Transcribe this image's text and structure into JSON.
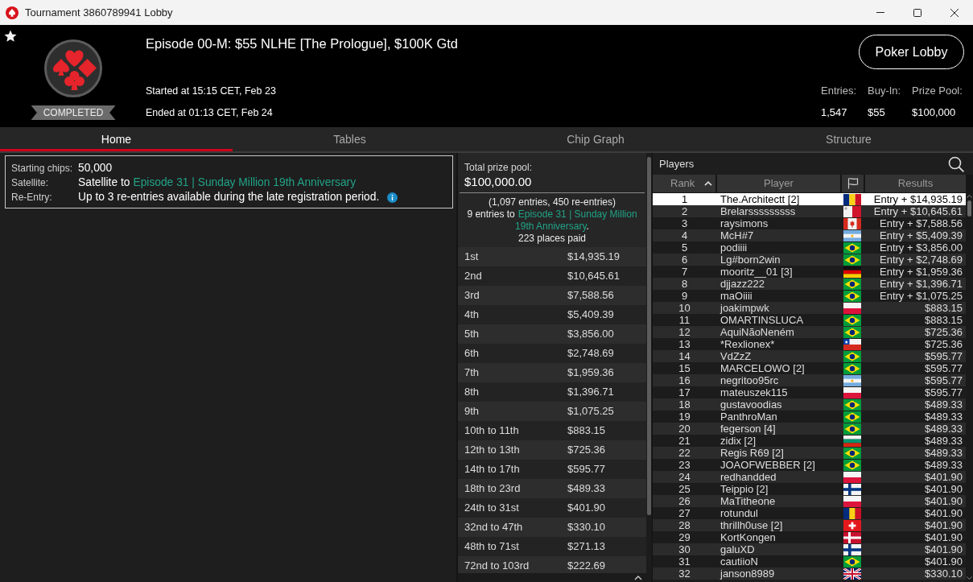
{
  "window": {
    "title": "Tournament 3860789941 Lobby"
  },
  "header": {
    "status": "COMPLETED",
    "title": "Episode 00-M: $55 NLHE [The Prologue], $100K Gtd",
    "started": "Started at 15:15 CET, Feb 23",
    "ended": "Ended at 01:13 CET, Feb 24",
    "lobby_button": "Poker Lobby",
    "stats": [
      {
        "label": "Entries:",
        "value": "1,547"
      },
      {
        "label": "Buy-In:",
        "value": "$55"
      },
      {
        "label": "Prize Pool:",
        "value": "$100,000"
      }
    ]
  },
  "tabs": [
    {
      "label": "Home",
      "selected": true
    },
    {
      "label": "Tables",
      "selected": false
    },
    {
      "label": "Chip Graph",
      "selected": false
    },
    {
      "label": "Structure",
      "selected": false
    }
  ],
  "details": [
    {
      "kind": "plain",
      "label": "Starting chips:",
      "value": "50,000"
    },
    {
      "kind": "link",
      "label": "Satellite:",
      "value": "Satellite to",
      "link": "Episode 31 | Sunday Million 19th Anniversary"
    },
    {
      "kind": "info",
      "label": "Re-Entry:",
      "value": "Up to 3 re-entries available during the late registration period."
    }
  ],
  "prize_pool": {
    "label": "Total prize pool:",
    "amount": "$100,000.00",
    "entries_note": "(1,097 entries, 450 re-entries)",
    "satellite_before": "9 entries to",
    "satellite_link_lines": [
      "Episode 31 | Sunday Million",
      "19th Anniversary"
    ],
    "satellite_after": ".",
    "places_paid": "223 places paid",
    "payouts": [
      {
        "place": "1st",
        "amount": "$14,935.19"
      },
      {
        "place": "2nd",
        "amount": "$10,645.61"
      },
      {
        "place": "3rd",
        "amount": "$7,588.56"
      },
      {
        "place": "4th",
        "amount": "$5,409.39"
      },
      {
        "place": "5th",
        "amount": "$3,856.00"
      },
      {
        "place": "6th",
        "amount": "$2,748.69"
      },
      {
        "place": "7th",
        "amount": "$1,959.36"
      },
      {
        "place": "8th",
        "amount": "$1,396.71"
      },
      {
        "place": "9th",
        "amount": "$1,075.25"
      },
      {
        "place": "10th to 11th",
        "amount": "$883.15"
      },
      {
        "place": "12th to 13th",
        "amount": "$725.36"
      },
      {
        "place": "14th to 17th",
        "amount": "$595.77"
      },
      {
        "place": "18th to 23rd",
        "amount": "$489.33"
      },
      {
        "place": "24th to 31st",
        "amount": "$401.90"
      },
      {
        "place": "32nd to 47th",
        "amount": "$330.10"
      },
      {
        "place": "48th to 71st",
        "amount": "$271.13"
      },
      {
        "place": "72nd to 103rd",
        "amount": "$222.69"
      }
    ]
  },
  "players": {
    "title": "Players",
    "columns": {
      "rank": "Rank",
      "player": "Player",
      "results": "Results"
    },
    "sort": {
      "kind": "ascending"
    },
    "rows": [
      {
        "rank": "1",
        "player": "The.Architectt [2]",
        "flag": {
          "kind": "romania"
        },
        "result": "Entry + $14,935.19",
        "selected": true
      },
      {
        "rank": "2",
        "player": "Brelarsssssssss",
        "flag": {
          "kind": "malta"
        },
        "result": "Entry + $10,645.61",
        "selected": false
      },
      {
        "rank": "3",
        "player": "raysimons",
        "flag": {
          "kind": "canada"
        },
        "result": "Entry + $7,588.56",
        "selected": false
      },
      {
        "rank": "4",
        "player": "McH#7",
        "flag": {
          "kind": "argentina"
        },
        "result": "Entry + $5,409.39",
        "selected": false
      },
      {
        "rank": "5",
        "player": "podiiii",
        "flag": {
          "kind": "brazil"
        },
        "result": "Entry + $3,856.00",
        "selected": false
      },
      {
        "rank": "6",
        "player": "Lg#born2win",
        "flag": {
          "kind": "brazil"
        },
        "result": "Entry + $2,748.69",
        "selected": false
      },
      {
        "rank": "7",
        "player": "mooritz__01 [3]",
        "flag": {
          "kind": "germany"
        },
        "result": "Entry + $1,959.36",
        "selected": false
      },
      {
        "rank": "8",
        "player": "djjazz222",
        "flag": {
          "kind": "brazil"
        },
        "result": "Entry + $1,396.71",
        "selected": false
      },
      {
        "rank": "9",
        "player": "maOiiii",
        "flag": {
          "kind": "brazil"
        },
        "result": "Entry + $1,075.25",
        "selected": false
      },
      {
        "rank": "10",
        "player": "joakimpwk",
        "flag": {
          "kind": "poland"
        },
        "result": "$883.15",
        "selected": false
      },
      {
        "rank": "11",
        "player": "OMARTINSLUCA",
        "flag": {
          "kind": "brazil"
        },
        "result": "$883.15",
        "selected": false
      },
      {
        "rank": "12",
        "player": "AquiNãoNeném",
        "flag": {
          "kind": "brazil"
        },
        "result": "$725.36",
        "selected": false
      },
      {
        "rank": "13",
        "player": "*Rexlionex*",
        "flag": {
          "kind": "chile"
        },
        "result": "$725.36",
        "selected": false
      },
      {
        "rank": "14",
        "player": "VdZzZ",
        "flag": {
          "kind": "brazil"
        },
        "result": "$595.77",
        "selected": false
      },
      {
        "rank": "15",
        "player": "MARCELOWO [2]",
        "flag": {
          "kind": "brazil"
        },
        "result": "$595.77",
        "selected": false
      },
      {
        "rank": "16",
        "player": "negritoo95rc",
        "flag": {
          "kind": "argentina"
        },
        "result": "$595.77",
        "selected": false
      },
      {
        "rank": "17",
        "player": "mateuszek115",
        "flag": {
          "kind": "poland"
        },
        "result": "$595.77",
        "selected": false
      },
      {
        "rank": "18",
        "player": "gustavoodias",
        "flag": {
          "kind": "brazil"
        },
        "result": "$489.33",
        "selected": false
      },
      {
        "rank": "19",
        "player": "PanthroMan",
        "flag": {
          "kind": "brazil"
        },
        "result": "$489.33",
        "selected": false
      },
      {
        "rank": "20",
        "player": "fegerson [4]",
        "flag": {
          "kind": "brazil"
        },
        "result": "$489.33",
        "selected": false
      },
      {
        "rank": "21",
        "player": "zidix [2]",
        "flag": {
          "kind": "bulgaria"
        },
        "result": "$489.33",
        "selected": false
      },
      {
        "rank": "22",
        "player": "Regis R69 [2]",
        "flag": {
          "kind": "brazil"
        },
        "result": "$489.33",
        "selected": false
      },
      {
        "rank": "23",
        "player": "JOAOFWEBBER [2]",
        "flag": {
          "kind": "brazil"
        },
        "result": "$489.33",
        "selected": false
      },
      {
        "rank": "24",
        "player": "redhandded",
        "flag": {
          "kind": "poland"
        },
        "result": "$401.90",
        "selected": false
      },
      {
        "rank": "25",
        "player": "Teippio [2]",
        "flag": {
          "kind": "finland"
        },
        "result": "$401.90",
        "selected": false
      },
      {
        "rank": "26",
        "player": "MaTitheone",
        "flag": {
          "kind": "poland"
        },
        "result": "$401.90",
        "selected": false
      },
      {
        "rank": "27",
        "player": "rotundul",
        "flag": {
          "kind": "romania"
        },
        "result": "$401.90",
        "selected": false
      },
      {
        "rank": "28",
        "player": "thrillh0use [2]",
        "flag": {
          "kind": "switzerland"
        },
        "result": "$401.90",
        "selected": false
      },
      {
        "rank": "29",
        "player": "KortKongen",
        "flag": {
          "kind": "denmark"
        },
        "result": "$401.90",
        "selected": false
      },
      {
        "rank": "30",
        "player": "galuXD",
        "flag": {
          "kind": "finland"
        },
        "result": "$401.90",
        "selected": false
      },
      {
        "rank": "31",
        "player": "cautiioN",
        "flag": {
          "kind": "brazil"
        },
        "result": "$401.90",
        "selected": false
      },
      {
        "rank": "32",
        "player": "janson8989",
        "flag": {
          "kind": "uk"
        },
        "result": "$330.10",
        "selected": false
      }
    ]
  }
}
